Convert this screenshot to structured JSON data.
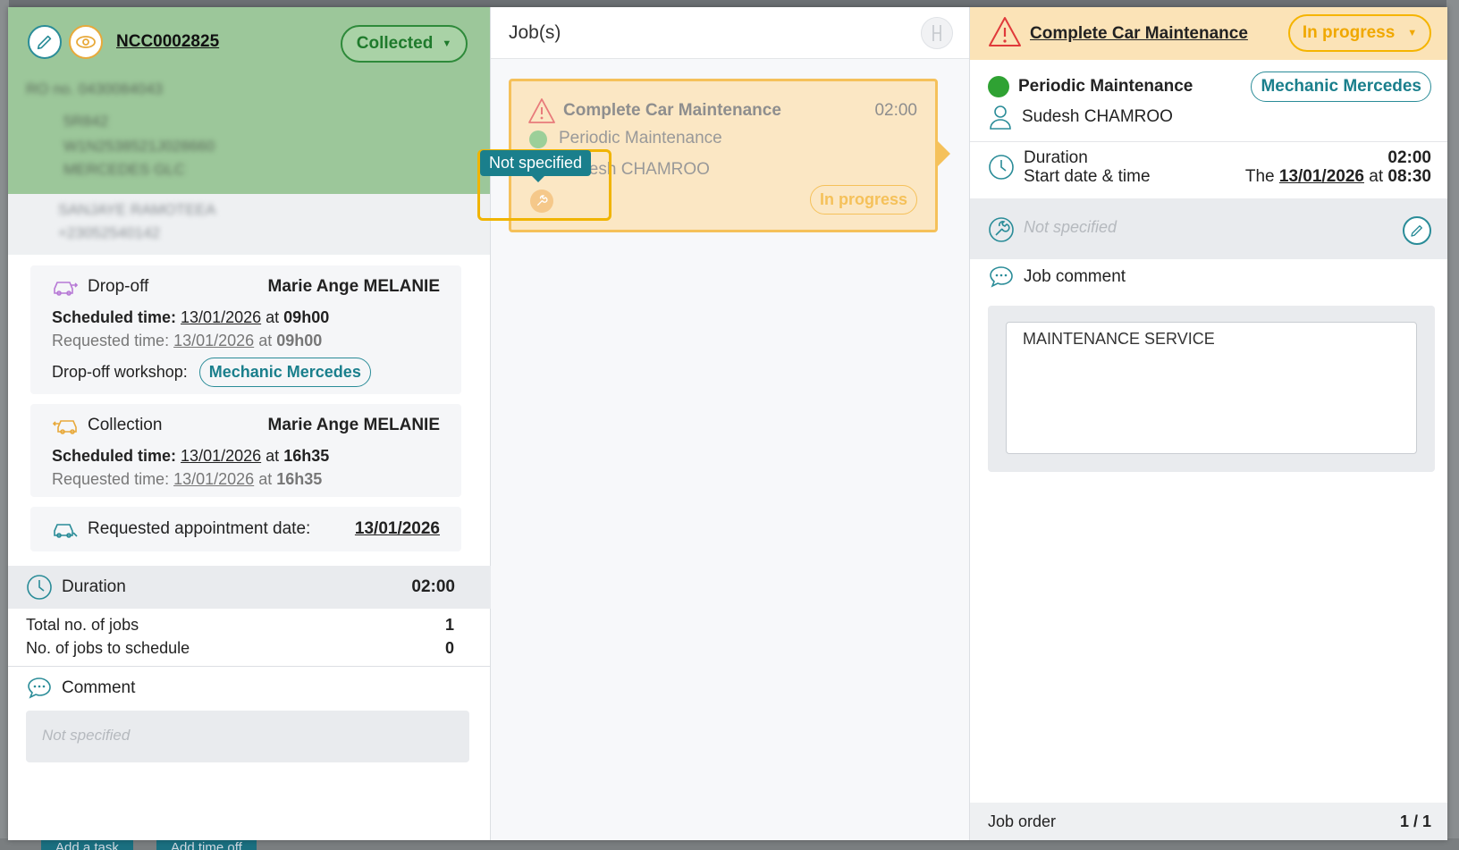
{
  "left": {
    "order_number": "NCC0002825",
    "status": "Collected",
    "dropoff": {
      "label": "Drop-off",
      "person": "Marie Ange MELANIE",
      "scheduled_label": "Scheduled time",
      "scheduled_date": "13/01/2026",
      "scheduled_at": "at",
      "scheduled_time": "09h00",
      "requested_label": "Requested time:",
      "requested_date": "13/01/2026",
      "requested_at": "at",
      "requested_time": "09h00",
      "workshop_label": "Drop-off workshop:",
      "workshop": "Mechanic Mercedes"
    },
    "collection": {
      "label": "Collection",
      "person": "Marie Ange MELANIE",
      "scheduled_label": "Scheduled time:",
      "scheduled_date": "13/01/2026",
      "scheduled_at": "at",
      "scheduled_time": "16h35",
      "requested_label": "Requested time:",
      "requested_date": "13/01/2026",
      "requested_at": "at",
      "requested_time": "16h35"
    },
    "appointment": {
      "label": "Requested appointment date:",
      "date": "13/01/2026"
    },
    "duration_label": "Duration",
    "duration_value": "02:00",
    "total_jobs_label": "Total no. of jobs",
    "total_jobs_value": "1",
    "jobs_to_schedule_label": "No. of jobs to schedule",
    "jobs_to_schedule_value": "0",
    "comment_label": "Comment",
    "comment_placeholder": "Not specified"
  },
  "middle": {
    "title": "Job(s)",
    "job": {
      "title": "Complete Car Maintenance",
      "time": "02:00",
      "type": "Periodic Maintenance",
      "technician": "Sudesh CHAMROO",
      "status": "In progress"
    },
    "tooltip": "Not specified"
  },
  "right": {
    "title": "Complete Car Maintenance",
    "status": "In progress",
    "type": "Periodic Maintenance",
    "workshop": "Mechanic Mercedes",
    "technician": "Sudesh CHAMROO",
    "duration_label": "Duration",
    "duration_value": "02:00",
    "start_label": "Start date & time",
    "start_prefix": "The",
    "start_date": "13/01/2026",
    "start_at": "at",
    "start_time": "08:30",
    "equipment_placeholder": "Not specified",
    "job_comment_label": "Job comment",
    "job_comment": "MAINTENANCE SERVICE",
    "job_order_label": "Job order",
    "job_order_value": "1 / 1"
  },
  "background": {
    "bottom_btn_1": "Add a task",
    "bottom_btn_2": "Add time off"
  },
  "colors": {
    "teal": "#1a7f8c",
    "green_header": "#9cc79a",
    "orange": "#f5b400"
  }
}
